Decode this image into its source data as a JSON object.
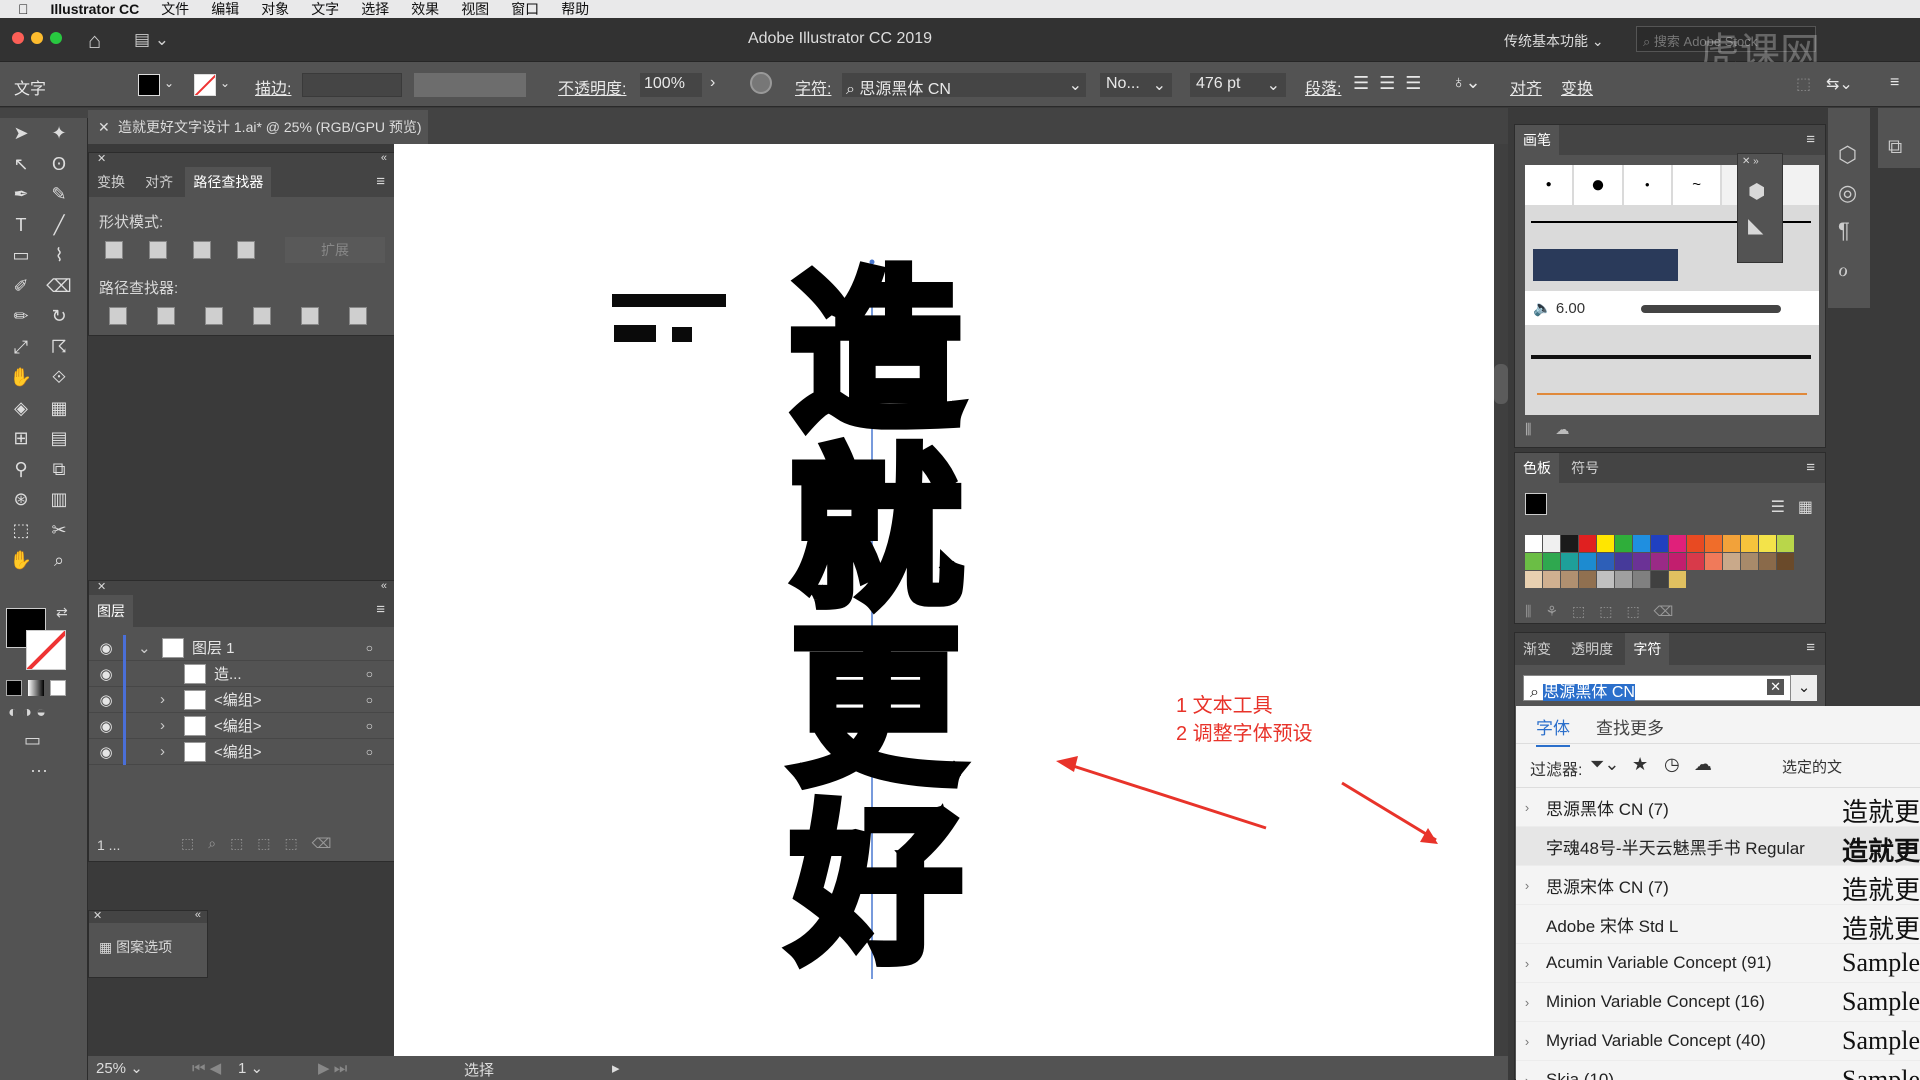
{
  "menubar": {
    "apple": "",
    "app": "Illustrator CC",
    "items": [
      "文件",
      "编辑",
      "对象",
      "文字",
      "选择",
      "效果",
      "视图",
      "窗口",
      "帮助"
    ]
  },
  "window": {
    "title": "Adobe Illustrator CC 2019",
    "workspace": "传统基本功能",
    "search_placeholder": "搜索 Adobe Stock",
    "watermark": "虎课网"
  },
  "control": {
    "tool_label": "文字",
    "stroke_label": "描边:",
    "opacity_label": "不透明度:",
    "opacity_value": "100%",
    "char_label": "字符:",
    "font_value": "思源黑体 CN",
    "style_value": "No...",
    "size_value": "476 pt",
    "para_label": "段落:",
    "align_label": "对齐",
    "transform_label": "变换"
  },
  "document": {
    "tab_title": "造就更好文字设计 1.ai* @ 25% (RGB/GPU 预览)",
    "close": "✕"
  },
  "pathfinder": {
    "tabs": [
      "变换",
      "对齐",
      "路径查找器"
    ],
    "shape_modes_label": "形状模式:",
    "expand_label": "扩展",
    "pathfinders_label": "路径查找器:"
  },
  "layers": {
    "title": "图层",
    "rows": [
      {
        "name": "图层 1",
        "expanded": true
      },
      {
        "name": "造..."
      },
      {
        "name": "<编组>"
      },
      {
        "name": "<编组>"
      },
      {
        "name": "<编组>"
      }
    ],
    "footer_count": "1 ..."
  },
  "pattern": {
    "label": "图案选项"
  },
  "artwork": {
    "chars": [
      "造",
      "就",
      "更",
      "好"
    ]
  },
  "annotation": {
    "line1": "1 文本工具",
    "line2": "2 调整字体预设"
  },
  "brushes": {
    "title": "画笔",
    "size_value": "6.00"
  },
  "swatches": {
    "tabs": [
      "色板",
      "符号"
    ]
  },
  "charpanel": {
    "tabs": [
      "渐变",
      "透明度",
      "字符"
    ],
    "search_value": "思源黑体 CN",
    "subtabs": [
      "字体",
      "查找更多"
    ],
    "filter_label": "过滤器:",
    "selected_text_label": "选定的文",
    "fonts": [
      {
        "name": "思源黑体 CN (7)",
        "sample": "造就更",
        "chev": "›"
      },
      {
        "name": "字魂48号-半天云魅黑手书 Regular",
        "sample": "造就更",
        "chev": ""
      },
      {
        "name": "思源宋体 CN (7)",
        "sample": "造就更",
        "chev": "›"
      },
      {
        "name": "Adobe 宋体 Std L",
        "sample": "造就更",
        "chev": ""
      },
      {
        "name": "Acumin Variable Concept (91)",
        "sample": "Sample",
        "chev": "›"
      },
      {
        "name": "Minion Variable Concept (16)",
        "sample": "Sample",
        "chev": "›"
      },
      {
        "name": "Myriad Variable Concept (40)",
        "sample": "Sample",
        "chev": "›"
      },
      {
        "name": "Skia (10)",
        "sample": "Sample",
        "chev": "›"
      }
    ]
  },
  "status": {
    "zoom": "25%",
    "page": "1",
    "tool": "选择"
  },
  "colors": {
    "accent": "#4a90d9",
    "annotation": "#e8332a",
    "menubar": "#e9e9ea",
    "panel": "#535353"
  }
}
